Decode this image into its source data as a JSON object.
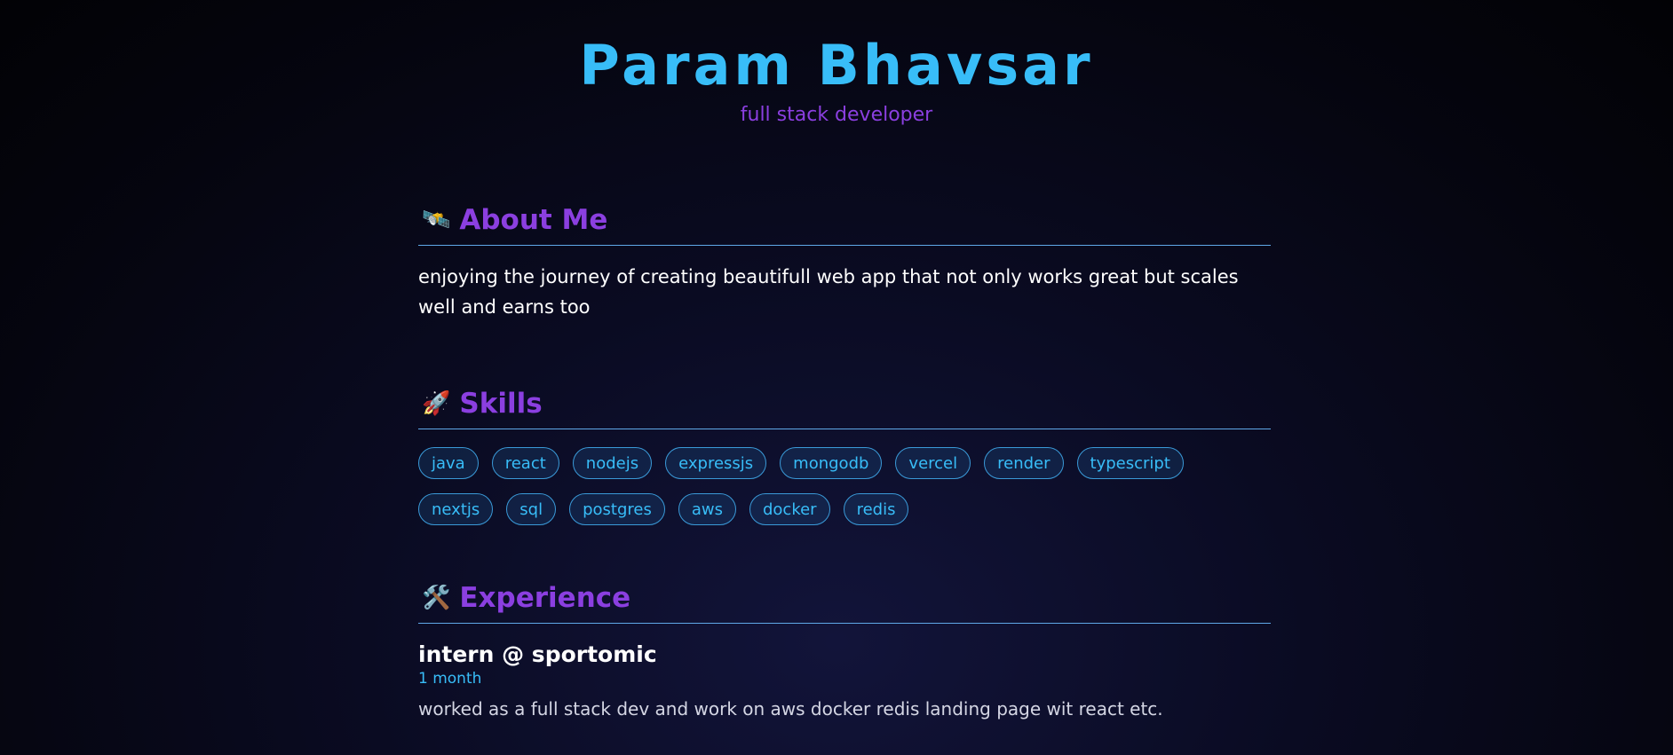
{
  "header": {
    "title": "Param Bhavsar",
    "subtitle": "full stack developer"
  },
  "about": {
    "icon": "satellite-icon",
    "emoji": "🛰️",
    "title": "About Me",
    "text": "enjoying the journey of creating beautifull web app that not only works great but scales well and earns too"
  },
  "skills": {
    "icon": "rocket-icon",
    "emoji": "🚀",
    "title": "Skills",
    "items": [
      "java",
      "react",
      "nodejs",
      "expressjs",
      "mongodb",
      "vercel",
      "render",
      "typescript",
      "nextjs",
      "sql",
      "postgres",
      "aws",
      "docker",
      "redis"
    ]
  },
  "experience": {
    "icon": "tools-icon",
    "emoji": "🛠️",
    "title": "Experience",
    "items": [
      {
        "role": "intern @ sportomic",
        "duration": "1 month",
        "description": "worked as a full stack dev and work on aws docker redis landing page wit react etc."
      }
    ]
  },
  "colors": {
    "accent": "#38bdf8",
    "heading": "#8b3fe0",
    "background": "#05050f"
  }
}
